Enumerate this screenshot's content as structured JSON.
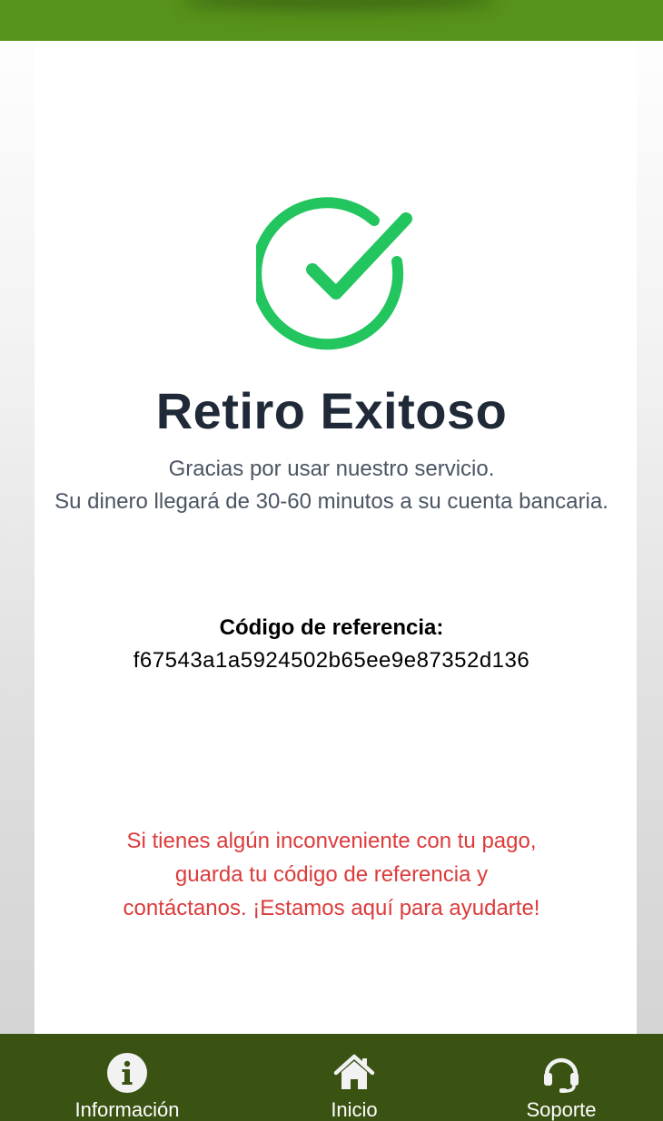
{
  "status": {
    "title": "Retiro Exitoso",
    "line1": "Gracias por usar nuestro servicio.",
    "line2": "Su dinero llegará de 30-60 minutos a su cuenta bancaria."
  },
  "reference": {
    "label": "Código de referencia:",
    "code": "f67543a1a5924502b65ee9e87352d136"
  },
  "notice": {
    "line1": "Si tienes algún inconveniente con tu pago,",
    "line2": "guarda tu código de referencia y",
    "line3": "contáctanos. ¡Estamos aquí para ayudarte!"
  },
  "nav": {
    "info": {
      "label": "Información",
      "icon": "info-icon"
    },
    "home": {
      "label": "Inicio",
      "icon": "home-icon"
    },
    "support": {
      "label": "Soporte",
      "icon": "headset-icon"
    }
  },
  "colors": {
    "top_bar": "#57921a",
    "bottom_nav": "#3a5212",
    "success": "#22c55e",
    "warning_text": "#dc3b3b"
  }
}
